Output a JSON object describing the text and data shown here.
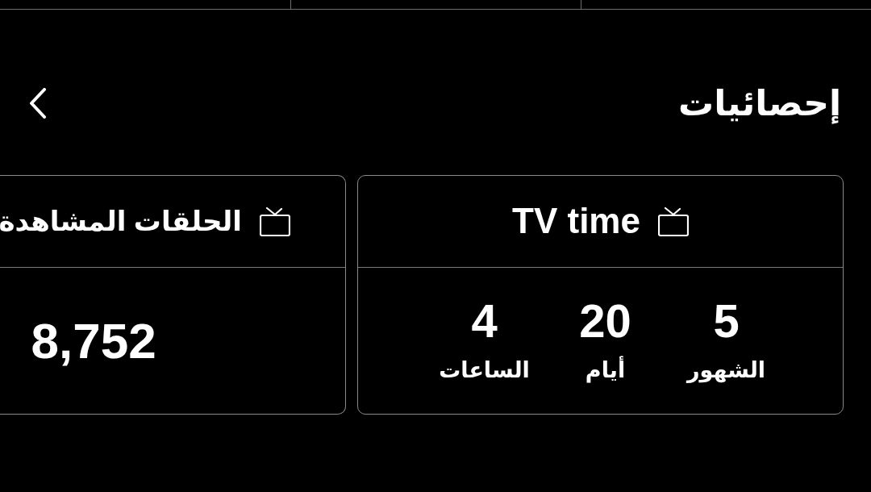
{
  "header": {
    "title": "إحصائيات"
  },
  "stats": [
    {
      "kind": "duration",
      "title": "TV time",
      "values": [
        {
          "value": "5",
          "unit": "الشهور"
        },
        {
          "value": "20",
          "unit": "أيام"
        },
        {
          "value": "4",
          "unit": "الساعات"
        }
      ]
    },
    {
      "kind": "count",
      "title": "الحلقات المشاهدة",
      "value": "8,752"
    }
  ]
}
